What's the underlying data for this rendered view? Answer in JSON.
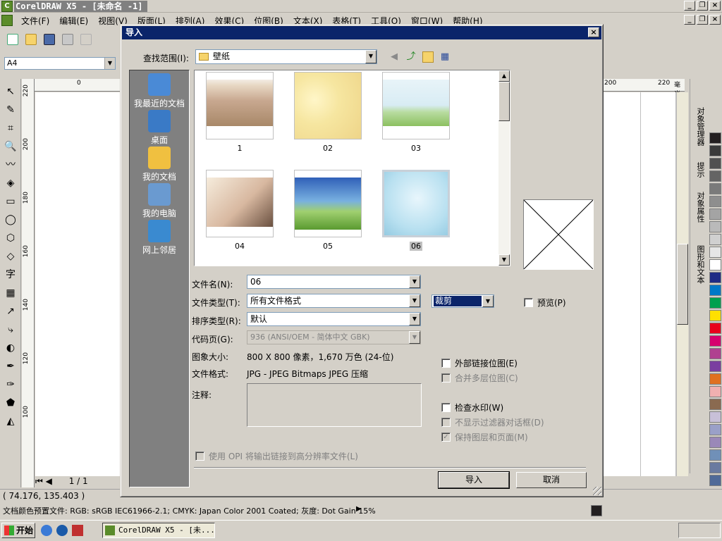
{
  "app": {
    "title": "CorelDRAW X5 - [未命名 -1]",
    "logo_letter": "C"
  },
  "menu": {
    "items": [
      "文件(F)",
      "编辑(E)",
      "视图(V)",
      "版面(L)",
      "排列(A)",
      "效果(C)",
      "位图(B)",
      "文本(X)",
      "表格(T)",
      "工具(O)",
      "窗口(W)",
      "帮助(H)"
    ]
  },
  "propbar": {
    "page_size": "A4"
  },
  "ruler": {
    "h_labels": [
      "0",
      "200",
      "220",
      "毫米"
    ],
    "v_labels": [
      "220",
      "200",
      "180",
      "160",
      "140",
      "120",
      "100"
    ]
  },
  "toolbox": {
    "items": [
      "pick-tool-icon",
      "shape-tool-icon",
      "crop-tool-icon",
      "zoom-tool-icon",
      "freehand-tool-icon",
      "smart-fill-icon",
      "rectangle-tool-icon",
      "ellipse-tool-icon",
      "polygon-tool-icon",
      "basic-shapes-icon",
      "text-tool-icon",
      "table-tool-icon",
      "dimension-tool-icon",
      "connector-tool-icon",
      "blend-tool-icon",
      "eyedropper-tool-icon",
      "outline-tool-icon",
      "fill-tool-icon",
      "interactive-fill-icon"
    ],
    "text_tool_glyph": "字"
  },
  "docker": {
    "tabs": [
      "对象管理器",
      "提示",
      "对象属性",
      "图形和文本"
    ]
  },
  "palette": {
    "colors": [
      "#231f20",
      "#3a3a3a",
      "#505050",
      "#646464",
      "#7a7a7a",
      "#8e8e8e",
      "#a4a4a4",
      "#bababa",
      "#d0d0d0",
      "#e6e6e6",
      "#ffffff",
      "#1f2b85",
      "#0078c8",
      "#00a04f",
      "#ffe000",
      "#e8001c",
      "#d6006e",
      "#b04090",
      "#7a3ea0",
      "#e07020",
      "#f0b0b0",
      "#8a6a50",
      "#c8c0d8",
      "#9aa0c8",
      "#9a88b8",
      "#7090b8",
      "#6a7aa0",
      "#506a98"
    ]
  },
  "page_nav": {
    "label": "1 / 1"
  },
  "status": {
    "coords": "( 74.176, 135.403 )",
    "color_profile": "文档颜色预置文件: RGB: sRGB IEC61966-2.1; CMYK: Japan Color 2001 Coated; 灰度: Dot Gain 15%"
  },
  "taskbar": {
    "start_label": "开始",
    "task_label": "CorelDRAW X5 - [未..."
  },
  "dialog": {
    "title": "导入",
    "close_glyph": "×",
    "look_in_label": "查找范围(I):",
    "look_in_value": "壁纸",
    "places": [
      {
        "label": "我最近的文档",
        "icon": "recent-docs-icon"
      },
      {
        "label": "桌面",
        "icon": "desktop-icon"
      },
      {
        "label": "我的文档",
        "icon": "my-documents-icon"
      },
      {
        "label": "我的电脑",
        "icon": "my-computer-icon"
      },
      {
        "label": "网上邻居",
        "icon": "network-places-icon"
      }
    ],
    "files": [
      {
        "name": "1",
        "theme": "beach-shell"
      },
      {
        "name": "02",
        "theme": "yellow-floral"
      },
      {
        "name": "03",
        "theme": "green-meadow-sky"
      },
      {
        "name": "04",
        "theme": "dandelion-macro"
      },
      {
        "name": "05",
        "theme": "rainbow-tree"
      },
      {
        "name": "06",
        "theme": "bird-blue-sky"
      }
    ],
    "selected_file": "06",
    "fields": {
      "file_name_label": "文件名(N):",
      "file_name_value": "06",
      "file_type_label": "文件类型(T):",
      "file_type_value": "所有文件格式",
      "sort_type_label": "排序类型(R):",
      "sort_type_value": "默认",
      "code_page_label": "代码页(G):",
      "code_page_value": "936  (ANSI/OEM - 简体中文 GBK)",
      "image_size_label": "图象大小:",
      "image_size_value": "800 X 800 像素，1,670 万色 (24-位)",
      "file_format_label": "文件格式:",
      "file_format_value": "JPG - JPEG Bitmaps JPEG 压缩",
      "notes_label": "注释:"
    },
    "crop_value": "裁剪",
    "checkboxes": {
      "preview": {
        "label": "预览(P)",
        "checked": false
      },
      "external_link": {
        "label": "外部链接位图(E)",
        "checked": false
      },
      "merge_layers": {
        "label": "合并多层位图(C)",
        "checked": false
      },
      "check_watermark": {
        "label": "检查水印(W)",
        "checked": false
      },
      "hide_filter_dialog": {
        "label": "不显示过滤器对话框(D)",
        "checked": false
      },
      "keep_layers_pages": {
        "label": "保持图层和页面(M)",
        "checked": true
      },
      "opi": {
        "label": "使用 OPI 将输出链接到高分辨率文件(L)",
        "checked": false
      }
    },
    "buttons": {
      "import": "导入",
      "cancel": "取消"
    }
  }
}
